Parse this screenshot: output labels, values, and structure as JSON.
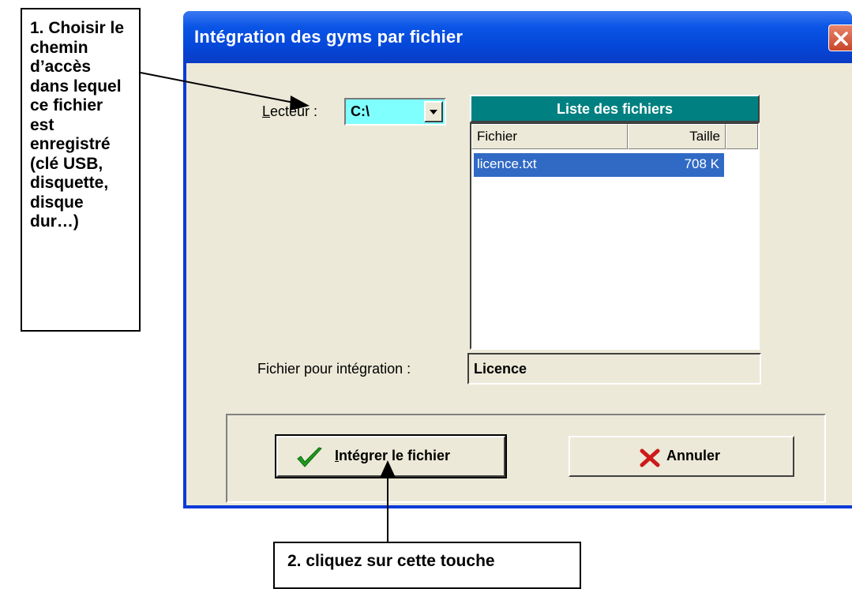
{
  "callout1": {
    "text": "1. Choisir le chemin d’accès dans lequel ce fichier est enregistré (clé USB, disquette, disque dur…)"
  },
  "callout2": {
    "text": "2. cliquez sur cette touche"
  },
  "window": {
    "title": "Intégration des gyms par fichier",
    "drive": {
      "label_prefix": "L",
      "label_rest": "ecteur :",
      "value": "C:\\"
    },
    "file_list": {
      "header": "Liste des fichiers",
      "columns": [
        "Fichier",
        "Taille"
      ],
      "rows": [
        {
          "name": "licence.txt",
          "size": "708 K",
          "selected": true
        }
      ]
    },
    "integration": {
      "label": "Fichier pour intégration :",
      "value": "Licence"
    },
    "buttons": {
      "integrate_prefix": "I",
      "integrate_rest": "ntégrer le fichier",
      "cancel": "Annuler"
    }
  },
  "colors": {
    "accent": "#0546d7",
    "list_header": "#008080",
    "selection": "#316ac5",
    "drive_bg": "#80ffff"
  }
}
